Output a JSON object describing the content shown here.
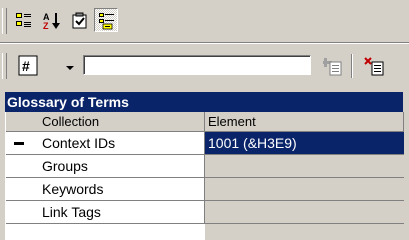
{
  "toolbar1": {
    "buttons": [
      {
        "name": "categorized",
        "icon": "categorized-icon",
        "pressed": false
      },
      {
        "name": "alphabetical",
        "icon": "sort-az-icon",
        "pressed": false
      },
      {
        "name": "property-pages",
        "icon": "checklist-icon",
        "pressed": false
      },
      {
        "name": "glossary",
        "icon": "glossary-icon",
        "pressed": true
      }
    ]
  },
  "toolbar2": {
    "combo_icon": "hash-icon",
    "input_value": "",
    "add_icon": "add-item-icon",
    "delete_icon": "delete-item-icon"
  },
  "glossary": {
    "title": "Glossary of Terms",
    "headers": {
      "collection": "Collection",
      "element": "Element"
    },
    "rows": [
      {
        "collection": "Context IDs",
        "element": "1001 (&H3E9)",
        "expanded": true,
        "selected": true
      },
      {
        "collection": "Groups",
        "element": ""
      },
      {
        "collection": "Keywords",
        "element": ""
      },
      {
        "collection": "Link Tags",
        "element": ""
      }
    ]
  },
  "colors": {
    "face": "#d4d0c8",
    "highlight": "#0a246a",
    "highlight_text": "#ffffff"
  }
}
